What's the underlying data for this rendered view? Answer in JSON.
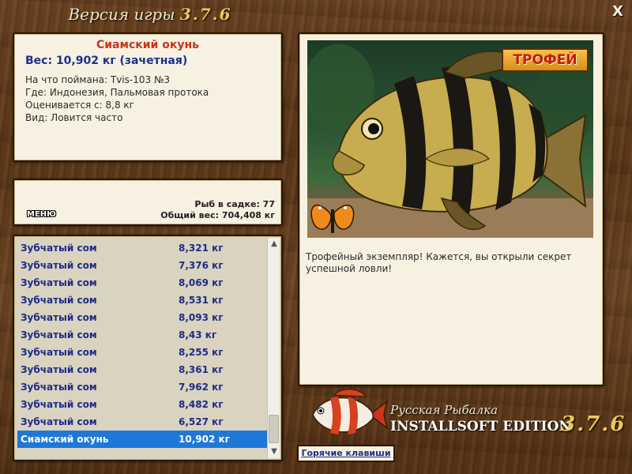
{
  "window": {
    "title_prefix": "Версия игры",
    "title_version": "3.7.6",
    "close_label": "X"
  },
  "fish_info": {
    "name": "Сиамский окунь",
    "weight_line": "Вес: 10,902 кг (зачетная)",
    "bait_line": "На что поймана: Tvis-103 №3",
    "place_line": "Где: Индонезия, Пальмовая протока",
    "value_line": "Оценивается с: 8,8 кг",
    "kind_line": "Вид: Ловится часто"
  },
  "stats": {
    "menu_label": "МЕНЮ",
    "fish_count": "Рыб в садке: 77",
    "total_weight": "Общий вес: 704,408 кг"
  },
  "catch_list": {
    "rows": [
      {
        "name": "Зубчатый сом",
        "weight": "8,321 кг"
      },
      {
        "name": "Зубчатый сом",
        "weight": "7,376 кг"
      },
      {
        "name": "Зубчатый сом",
        "weight": "8,069 кг"
      },
      {
        "name": "Зубчатый сом",
        "weight": "8,531 кг"
      },
      {
        "name": "Зубчатый сом",
        "weight": "8,093 кг"
      },
      {
        "name": "Зубчатый сом",
        "weight": "8,43 кг"
      },
      {
        "name": "Зубчатый сом",
        "weight": "8,255 кг"
      },
      {
        "name": "Зубчатый сом",
        "weight": "8,361 кг"
      },
      {
        "name": "Зубчатый сом",
        "weight": "7,962 кг"
      },
      {
        "name": "Зубчатый сом",
        "weight": "8,482 кг"
      },
      {
        "name": "Зубчатый сом",
        "weight": "6,527 кг"
      },
      {
        "name": "Сиамский окунь",
        "weight": "10,902 кг"
      }
    ],
    "selected_index": 11
  },
  "picture": {
    "badge": "ТРОФЕЙ",
    "description": "Трофейный экземпляр! Кажется, вы открыли секрет успешной ловли!"
  },
  "logo": {
    "line1": "Русская Рыбалка",
    "line2": "INSTALLSOFT EDITION",
    "version": "3.7.6"
  },
  "hotkeys_label": "Горячие клавиши",
  "colors": {
    "fish_name": "#c4361b",
    "weight_text": "#1c2f8e",
    "list_text": "#1e2b88",
    "selection": "#1e78d8",
    "panel_bg": "#f7f1e1",
    "version_gold": "#f0c95a"
  }
}
